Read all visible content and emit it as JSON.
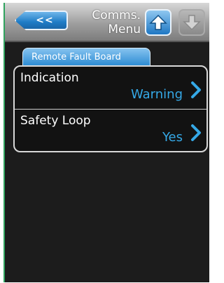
{
  "header": {
    "back_label": "<<",
    "title_line1": "Comms.",
    "title_line2": "Menu"
  },
  "icons": {
    "up": "arrow-up-icon",
    "down": "arrow-down-icon",
    "chevron": "chevron-right-icon"
  },
  "tab": {
    "label": "Remote Fault Board"
  },
  "rows": [
    {
      "label": "Indication",
      "value": "Warning"
    },
    {
      "label": "Safety Loop",
      "value": "Yes"
    }
  ],
  "colors": {
    "accent": "#1f7cc6",
    "value_text": "#35a8e6",
    "background": "#1c1c1c"
  }
}
